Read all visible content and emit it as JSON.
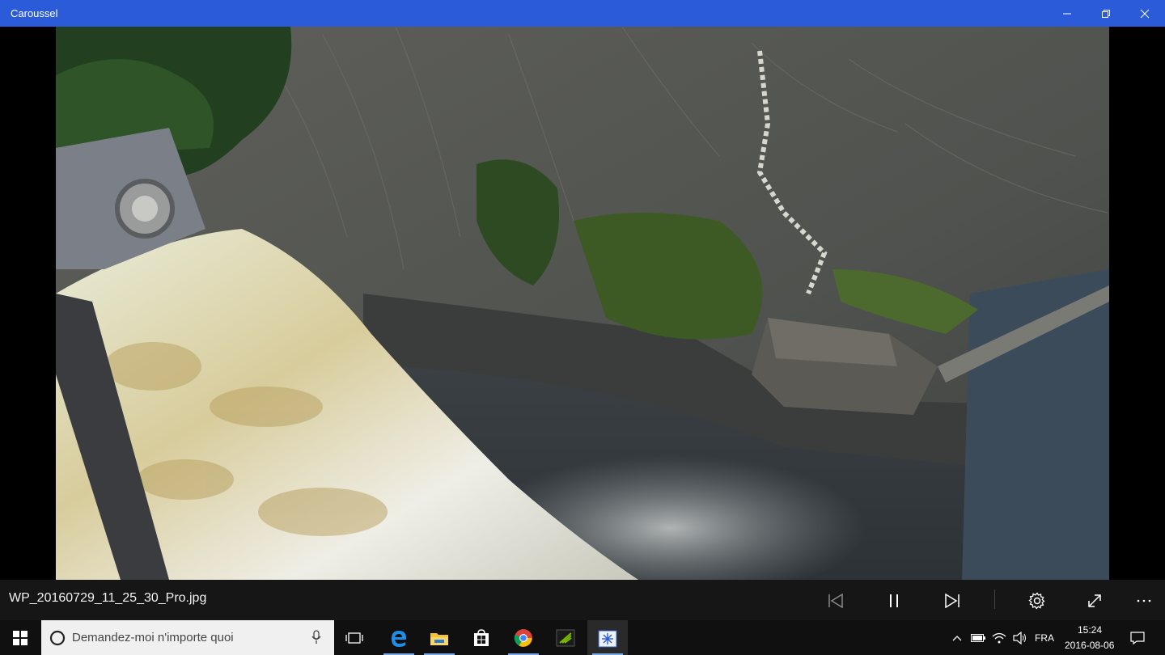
{
  "window": {
    "title": "Caroussel"
  },
  "viewer": {
    "filename": "WP_20160729_11_25_30_Pro.jpg",
    "photo_alt": "Waterfall viewed from above"
  },
  "taskbar": {
    "search_placeholder": "Demandez-moi n'importe quoi",
    "language": "FRA",
    "time": "15:24",
    "date": "2016-08-06"
  },
  "icons": {
    "start": "windows-logo-icon",
    "edge": "edge-icon",
    "explorer": "folder-icon",
    "store": "store-icon",
    "chrome": "chrome-icon",
    "nvidia": "nvidia-icon",
    "carousel": "carousel-app-icon"
  },
  "colors": {
    "titlebar": "#2b5bd8",
    "controlbar": "#161616",
    "taskbar": "#101010"
  }
}
